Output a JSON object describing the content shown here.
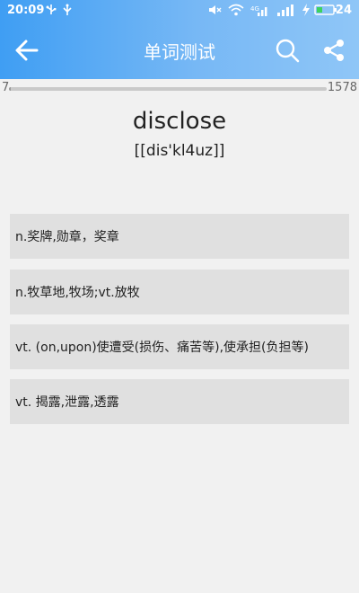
{
  "status_bar": {
    "time": "20:09",
    "battery_level": "24",
    "icons": [
      "usb-icon",
      "usb-debug-icon",
      "mute-icon",
      "wifi-icon",
      "signal-4g-icon",
      "signal-icon",
      "charging-icon",
      "battery-icon"
    ]
  },
  "nav": {
    "title": "单词测试",
    "back_icon": "arrow-left-icon",
    "search_icon": "search-icon",
    "share_icon": "share-icon"
  },
  "progress": {
    "current": "7",
    "total": "1578",
    "fraction": 0.0044
  },
  "question": {
    "word": "disclose",
    "phonetic": "[[dis'kl4uz]]"
  },
  "options": [
    "n.奖牌,勋章，奖章",
    "n.牧草地,牧场;vt.放牧",
    "vt. (on,upon)使遭受(损伤、痛苦等),使承担(负担等)",
    "vt. 揭露,泄露,透露"
  ],
  "colors": {
    "header_start": "#3f9ef3",
    "header_end": "#8fc6f7",
    "option_bg": "#e0e0e0",
    "page_bg": "#f1f1f1"
  }
}
